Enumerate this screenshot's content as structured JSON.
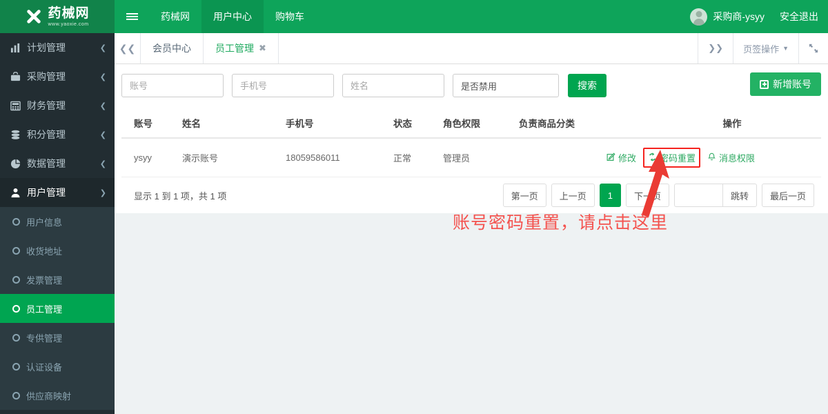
{
  "header": {
    "logo_title": "药械网",
    "logo_sub": "www.yaoxie.com",
    "logo_icon": "x-cross-logo-icon",
    "menu_icon": "hamburger-icon",
    "nav": [
      {
        "label": "药械网",
        "active": false
      },
      {
        "label": "用户中心",
        "active": true
      },
      {
        "label": "购物车",
        "active": false
      }
    ],
    "user_name": "采购商-ysyy",
    "avatar_icon": "user-avatar-icon",
    "logout_label": "安全退出"
  },
  "sidebar": {
    "items": [
      {
        "label": "计划管理",
        "icon": "bar-chart-icon",
        "chevron": "chevron-left-icon"
      },
      {
        "label": "采购管理",
        "icon": "briefcase-icon",
        "chevron": "chevron-left-icon"
      },
      {
        "label": "财务管理",
        "icon": "calculator-icon",
        "chevron": "chevron-left-icon"
      },
      {
        "label": "积分管理",
        "icon": "database-icon",
        "chevron": "chevron-left-icon"
      },
      {
        "label": "数据管理",
        "icon": "pie-chart-icon",
        "chevron": "chevron-left-icon"
      },
      {
        "label": "用户管理",
        "icon": "user-icon",
        "chevron": "chevron-down-icon",
        "expanded": true
      }
    ],
    "submenu": [
      {
        "label": "用户信息",
        "active": false
      },
      {
        "label": "收货地址",
        "active": false
      },
      {
        "label": "发票管理",
        "active": false
      },
      {
        "label": "员工管理",
        "active": true
      },
      {
        "label": "专供管理",
        "active": false
      },
      {
        "label": "认证设备",
        "active": false
      },
      {
        "label": "供应商映射",
        "active": false
      }
    ]
  },
  "tabstrip": {
    "prev_icon": "double-chevron-left-icon",
    "next_icon": "double-chevron-right-icon",
    "tabs": [
      {
        "label": "会员中心",
        "active": false,
        "closable": false
      },
      {
        "label": "员工管理",
        "active": true,
        "closable": true
      }
    ],
    "close_icon": "close-x-icon",
    "ops_label": "页签操作",
    "ops_caret_icon": "caret-down-icon",
    "fullscreen_icon": "expand-arrows-icon"
  },
  "filters": {
    "account_placeholder": "账号",
    "account_value": "",
    "phone_placeholder": "手机号",
    "phone_value": "",
    "name_placeholder": "姓名",
    "name_value": "",
    "disabled_select_value": "是否禁用",
    "search_label": "搜索",
    "add_label": "新增账号",
    "add_icon": "plus-square-icon"
  },
  "table": {
    "columns": [
      "账号",
      "姓名",
      "手机号",
      "状态",
      "角色权限",
      "负责商品分类",
      "操作"
    ],
    "rows": [
      {
        "account": "ysyy",
        "name": "演示账号",
        "phone": "18059586011",
        "status": "正常",
        "role": "管理员",
        "category": "",
        "actions": [
          {
            "label": "修改",
            "icon": "edit-pencil-icon",
            "highlighted": false
          },
          {
            "label": "密码重置",
            "icon": "refresh-circle-icon",
            "highlighted": true
          },
          {
            "label": "消息权限",
            "icon": "bell-icon",
            "highlighted": false
          }
        ]
      }
    ]
  },
  "pagination": {
    "info": "显示 1 到 1 项，共 1 项",
    "first_label": "第一页",
    "prev_label": "上一页",
    "current_page": "1",
    "next_label": "下一页",
    "jump_input_value": "",
    "jump_label": "跳转",
    "last_label": "最后一页"
  },
  "annotation": {
    "text": "账号密码重置，请点击这里",
    "arrow_icon": "red-arrow-up-icon",
    "color": "#f4534f",
    "highlight_box_color": "#f5231f"
  },
  "colors": {
    "brand_green": "#0ea45a",
    "logo_green": "#11834a",
    "accent_green": "#00a54f",
    "sidebar_dark": "#222d32",
    "submenu_dark": "#2c3b41",
    "content_bg": "#eef2f3"
  }
}
